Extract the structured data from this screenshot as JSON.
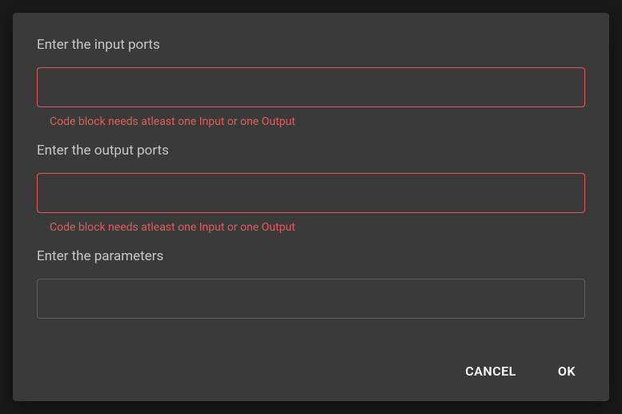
{
  "fields": {
    "input_ports": {
      "label": "Enter the input ports",
      "value": "",
      "error": "Code block needs atleast one Input or one Output"
    },
    "output_ports": {
      "label": "Enter the output ports",
      "value": "",
      "error": "Code block needs atleast one Input or one Output"
    },
    "parameters": {
      "label": "Enter the parameters",
      "value": ""
    }
  },
  "buttons": {
    "cancel": "CANCEL",
    "ok": "OK"
  }
}
